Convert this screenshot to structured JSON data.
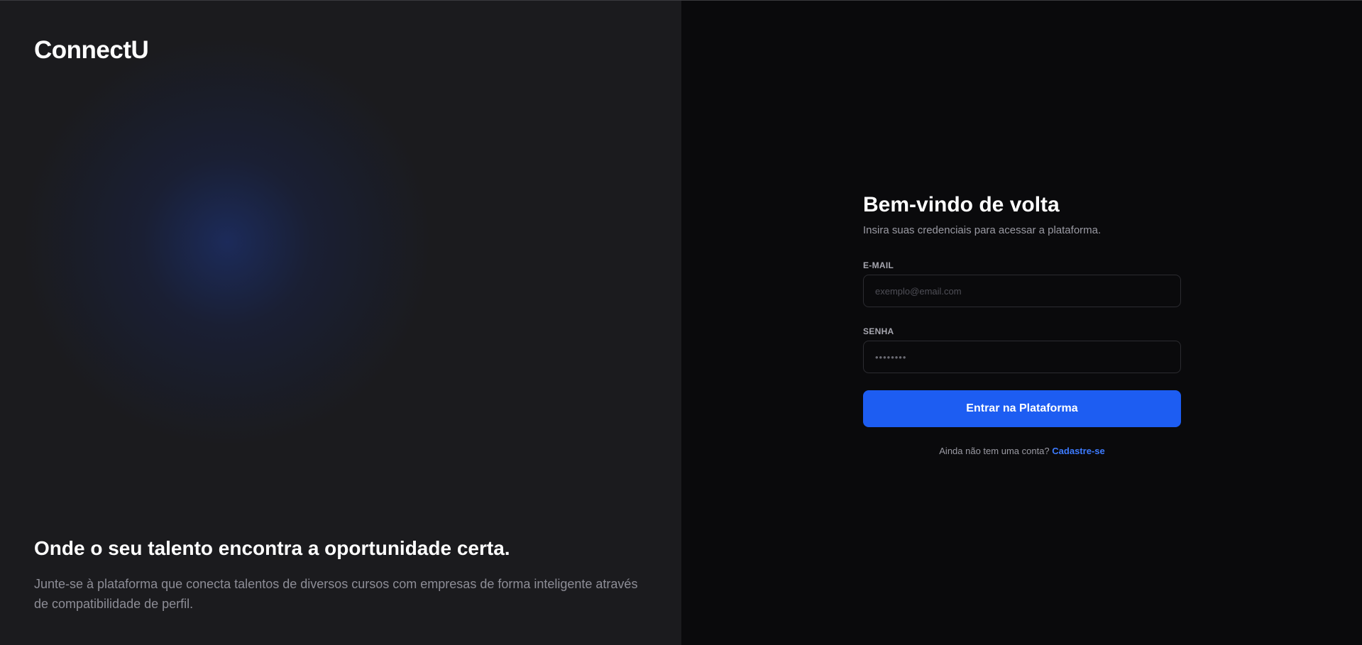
{
  "brand": {
    "name": "ConnectU"
  },
  "hero": {
    "title": "Onde o seu talento encontra a oportunidade certa.",
    "description": "Junte-se à plataforma que conecta talentos de diversos cursos com empresas de forma inteligente através de compatibilidade de perfil."
  },
  "login": {
    "title": "Bem-vindo de volta",
    "subtitle": "Insira suas credenciais para acessar a plataforma.",
    "email": {
      "label": "E-MAIL",
      "value": "",
      "placeholder": "exemplo@email.com"
    },
    "password": {
      "label": "SENHA",
      "value": "",
      "placeholder": "••••••••"
    },
    "submit_label": "Entrar na Plataforma",
    "signup_prompt": "Ainda não tem uma conta?",
    "signup_link": "Cadastre-se"
  },
  "colors": {
    "accent": "#1d5df2",
    "link": "#3d7bff",
    "left_panel_bg": "#1b1b1e",
    "right_panel_bg": "#0a0a0c"
  }
}
